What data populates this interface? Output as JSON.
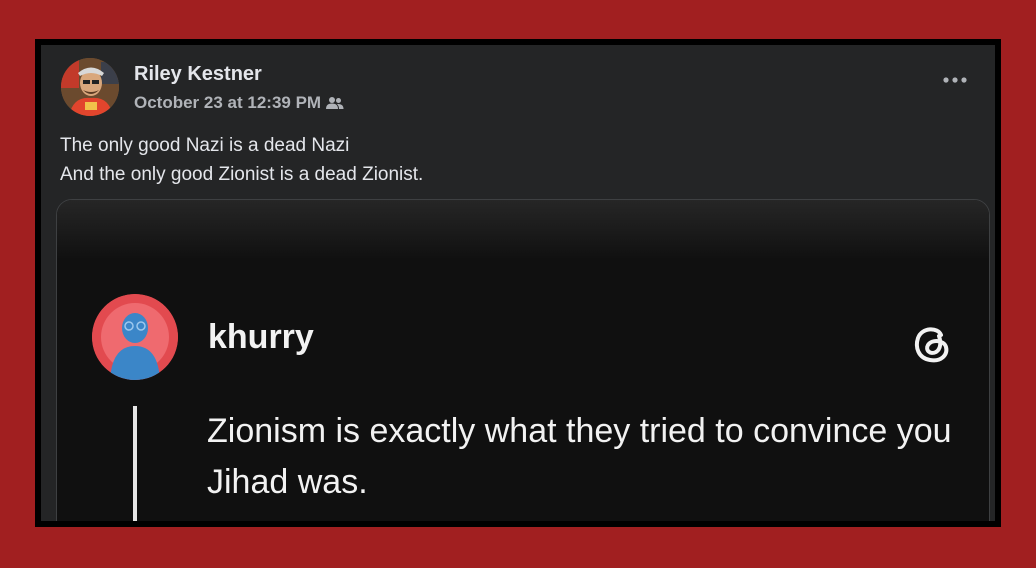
{
  "post": {
    "author": "Riley Kestner",
    "timestamp": "October 23 at 12:39 PM",
    "audience_icon": "friends-icon",
    "more_icon": "more-horizontal-icon",
    "text_lines": [
      "The only good Nazi is a dead Nazi",
      "And the only good Zionist is a dead Zionist."
    ]
  },
  "embed": {
    "username": "khurry",
    "logo_icon": "threads-logo-icon",
    "text": "Zionism is exactly what they tried to convince you Jihad was."
  },
  "colors": {
    "background": "#a11f20",
    "card": "#242526",
    "embed": "#101010",
    "text_primary": "#e4e6eb",
    "text_secondary": "#b0b3b8",
    "avatar_ring": "#e24a4f",
    "avatar_figure": "#3b86c8"
  }
}
